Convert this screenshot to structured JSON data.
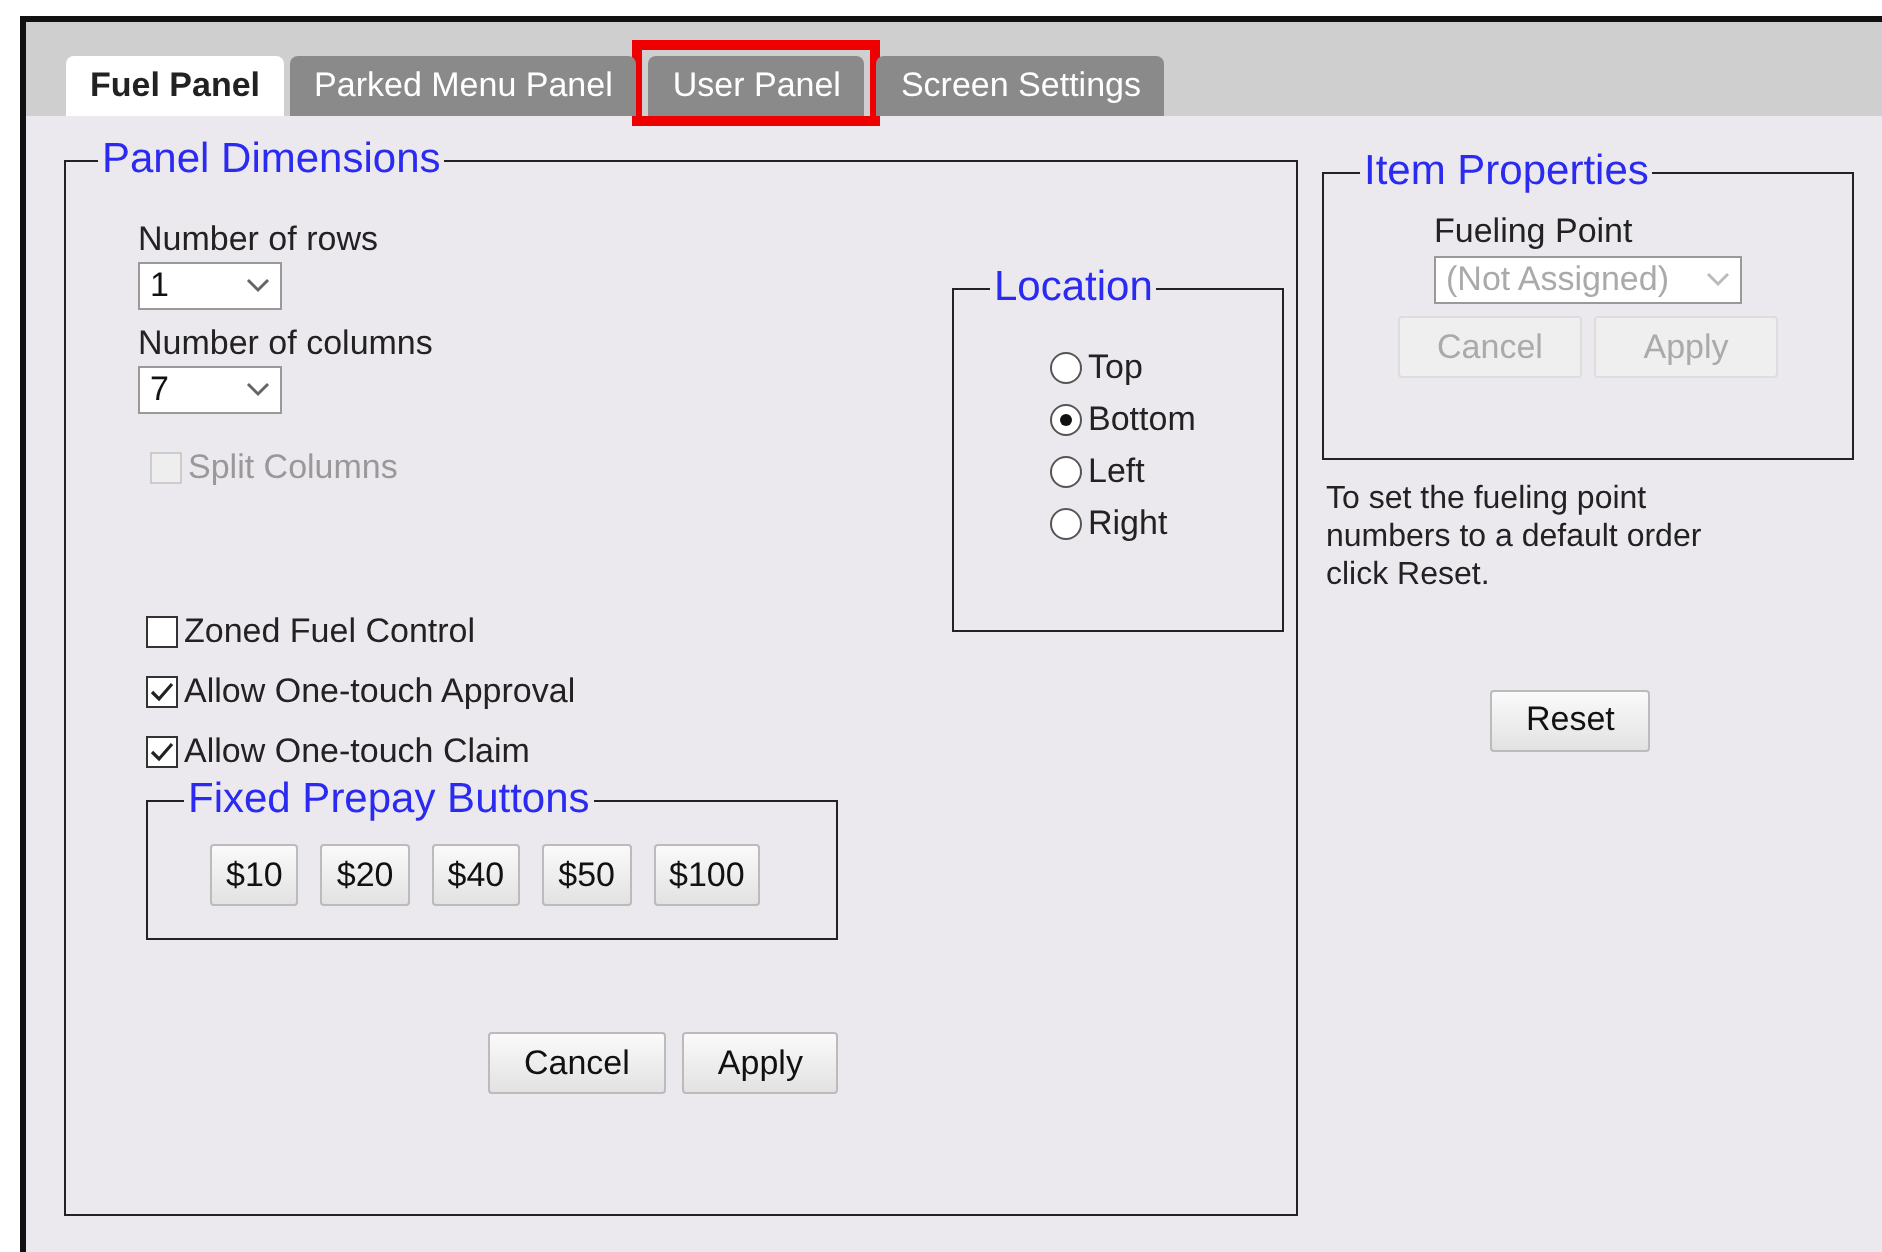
{
  "tabs": [
    {
      "label": "Fuel Panel",
      "selected": true,
      "highlighted": false
    },
    {
      "label": "Parked Menu Panel",
      "selected": false,
      "highlighted": false
    },
    {
      "label": "User Panel",
      "selected": false,
      "highlighted": true
    },
    {
      "label": "Screen Settings",
      "selected": false,
      "highlighted": false
    }
  ],
  "panel_dimensions": {
    "legend": "Panel Dimensions",
    "selects": [
      {
        "label": "Number of rows",
        "value": "1"
      },
      {
        "label": "Number of columns",
        "value": "7"
      }
    ],
    "split_columns": {
      "label": "Split Columns",
      "checked": false,
      "disabled": true
    },
    "checkboxes": [
      {
        "label": "Zoned Fuel Control",
        "checked": false
      },
      {
        "label": "Allow One-touch Approval",
        "checked": true
      },
      {
        "label": "Allow One-touch Claim",
        "checked": true
      }
    ],
    "location": {
      "legend": "Location",
      "options": [
        {
          "label": "Top",
          "selected": false
        },
        {
          "label": "Bottom",
          "selected": true
        },
        {
          "label": "Left",
          "selected": false
        },
        {
          "label": "Right",
          "selected": false
        }
      ]
    },
    "fixed_prepay": {
      "legend": "Fixed Prepay Buttons",
      "buttons": [
        "$10",
        "$20",
        "$40",
        "$50",
        "$100"
      ]
    },
    "buttons": [
      {
        "label": "Cancel",
        "disabled": false
      },
      {
        "label": "Apply",
        "disabled": false
      }
    ]
  },
  "item_properties": {
    "legend": "Item Properties",
    "field_label": "Fueling Point",
    "select": {
      "value": "(Not Assigned)",
      "disabled": true
    },
    "buttons": [
      {
        "label": "Cancel",
        "disabled": true
      },
      {
        "label": "Apply",
        "disabled": true
      }
    ]
  },
  "note": "To set the fueling point numbers to a default order click Reset.",
  "reset_button": {
    "label": "Reset",
    "disabled": false
  }
}
